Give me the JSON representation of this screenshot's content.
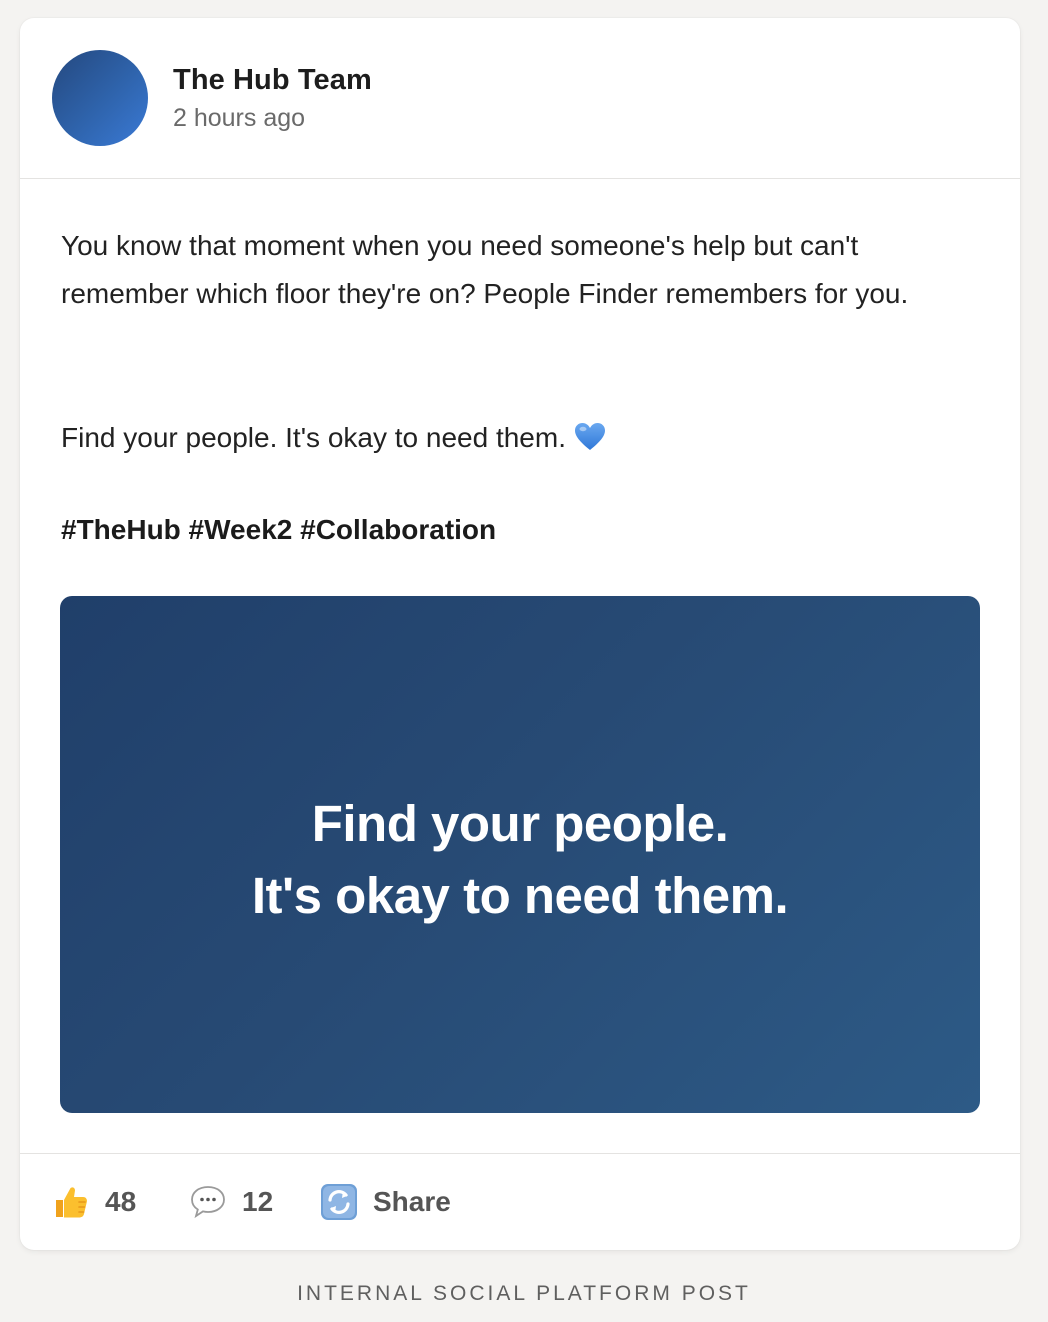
{
  "post": {
    "author": "The Hub Team",
    "time": "2 hours ago",
    "paragraph1": "You know that moment when you need someone's help but can't remember which floor they're on? People Finder remembers for you.",
    "paragraph2": "Find your people. It's okay to need them.",
    "emoji": "blue-heart",
    "hashtags": "#TheHub #Week2 #Collaboration",
    "media": {
      "line1": "Find your people.",
      "line2": "It's okay to need them."
    }
  },
  "actions": {
    "likes": "48",
    "comments": "12",
    "share_label": "Share"
  },
  "caption": "INTERNAL SOCIAL PLATFORM POST",
  "colors": {
    "media_background": "#274a74",
    "avatar": "#2f64ad",
    "page_background": "#f4f3f1"
  }
}
